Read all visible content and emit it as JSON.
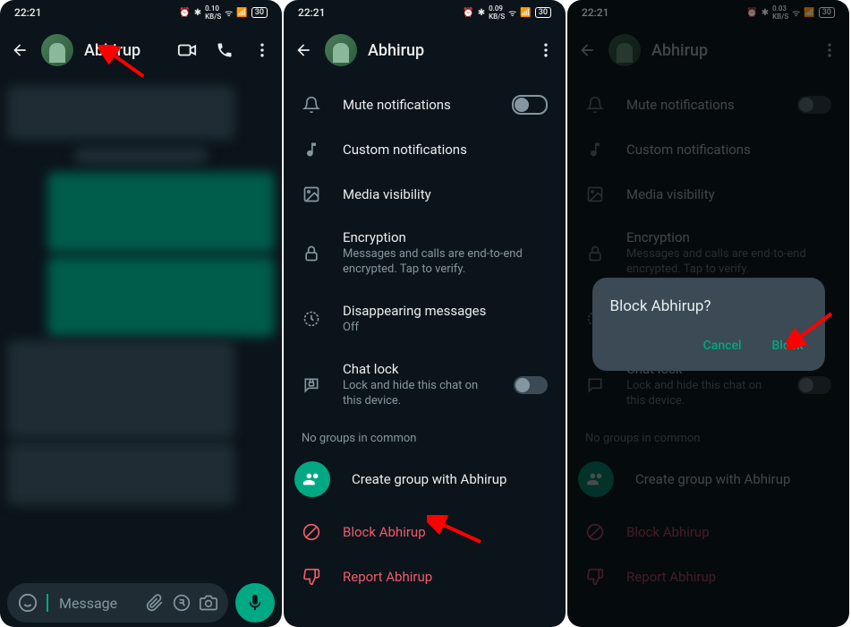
{
  "status": {
    "time": "22:21",
    "data1": "0.10",
    "data2": "0.09",
    "data3": "0.03",
    "unit": "KB/S",
    "battery": "30"
  },
  "contact": "Abhirup",
  "input": {
    "placeholder": "Message"
  },
  "settings": {
    "mute": "Mute notifications",
    "custom": "Custom notifications",
    "media": "Media visibility",
    "encryption": "Encryption",
    "encryption_sub": "Messages and calls are end-to-end encrypted. Tap to verify.",
    "disappearing": "Disappearing messages",
    "disappearing_sub": "Off",
    "chatlock": "Chat lock",
    "chatlock_sub": "Lock and hide this chat on this device.",
    "no_groups": "No groups in common",
    "create_group": "Create group with Abhirup",
    "block": "Block Abhirup",
    "report": "Report Abhirup"
  },
  "dialog": {
    "title": "Block Abhirup?",
    "cancel": "Cancel",
    "block": "Block"
  }
}
